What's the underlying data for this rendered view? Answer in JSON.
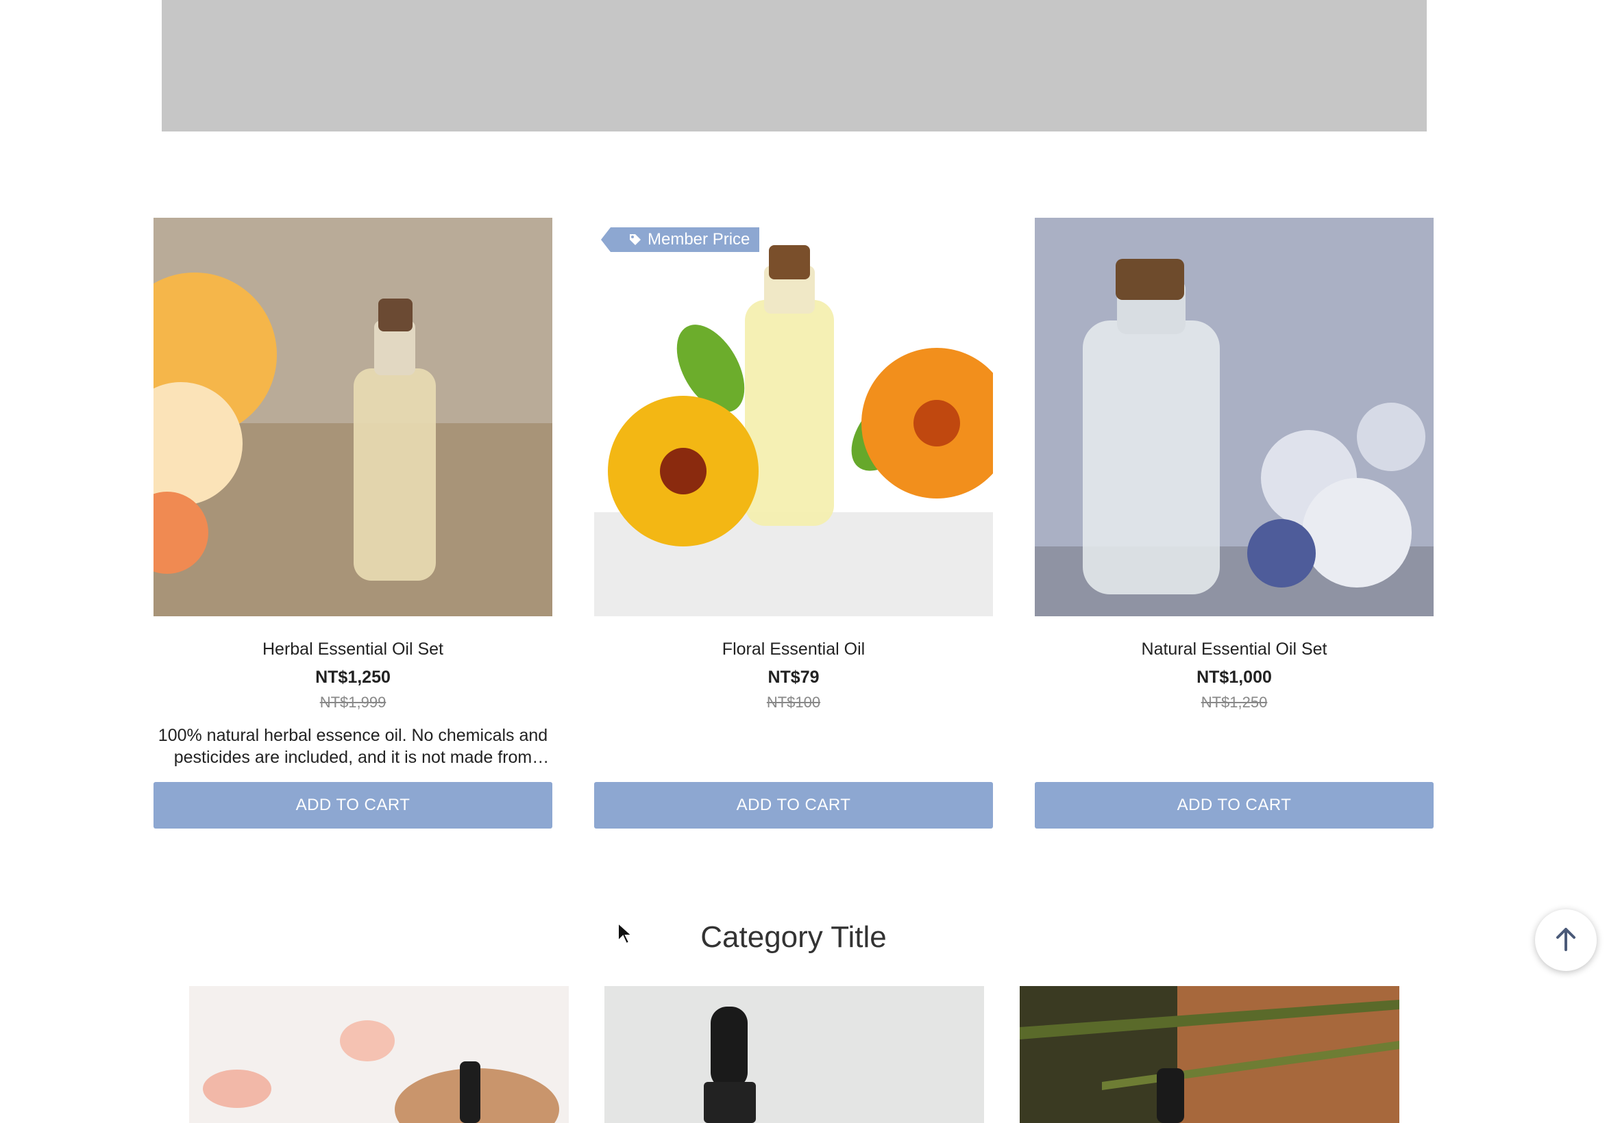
{
  "banner": {},
  "products": [
    {
      "name": "Herbal Essential Oil Set",
      "price": "NT$1,250",
      "original_price": "NT$1,999",
      "description": "100% natural herbal essence oil. No chemicals and pesticides are included, and it is not made from GMO sources.",
      "button": "ADD TO CART",
      "badge": ""
    },
    {
      "name": "Floral Essential Oil",
      "price": "NT$79",
      "original_price": "NT$100",
      "description": "",
      "button": "ADD TO CART",
      "badge": "Member Price"
    },
    {
      "name": "Natural Essential Oil Set",
      "price": "NT$1,000",
      "original_price": "NT$1,250",
      "description": "",
      "button": "ADD TO CART",
      "badge": ""
    }
  ],
  "category": {
    "title": "Category Title"
  },
  "icons": {
    "badge_icon": "tag-icon",
    "back_to_top": "arrow-up-icon"
  },
  "colors": {
    "accent": "#8da7d1",
    "banner": "#c6c6c6"
  }
}
